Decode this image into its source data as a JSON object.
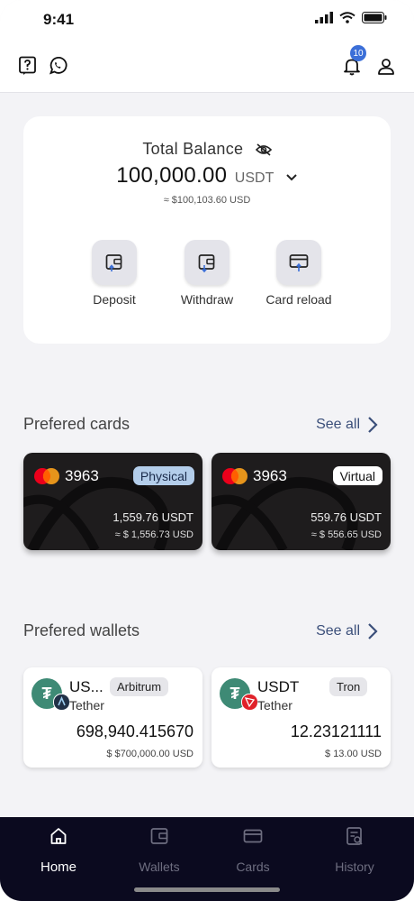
{
  "status_bar": {
    "time": "9:41"
  },
  "header": {
    "notification_count": "10"
  },
  "balance": {
    "label": "Total Balance",
    "amount": "100,000.00",
    "currency": "USDT",
    "usd_equivalent": "≈ $100,103.60  USD",
    "actions": [
      {
        "label": "Deposit",
        "icon": "wallet-in-icon"
      },
      {
        "label": "Withdraw",
        "icon": "wallet-out-icon"
      },
      {
        "label": "Card reload",
        "icon": "card-reload-icon"
      }
    ]
  },
  "preferred_cards": {
    "title": "Prefered cards",
    "see_all": "See all",
    "cards": [
      {
        "last_digits": "3963",
        "type": "Physical",
        "amount": "1,559.76  USDT",
        "usd": "≈ $ 1,556.73  USD",
        "tag_bg": "#b3cdea",
        "tag_color": "#1a2a4a"
      },
      {
        "last_digits": "3963",
        "type": "Virtual",
        "amount": "559.76  USDT",
        "usd": "≈ $ 556.65  USD",
        "tag_bg": "#ffffff",
        "tag_color": "#111111"
      }
    ]
  },
  "preferred_wallets": {
    "title": "Prefered wallets",
    "see_all": "See all",
    "wallets": [
      {
        "symbol": "US...",
        "name": "Tether",
        "network": "Arbitrum",
        "balance": "698,940.415670",
        "usd": "$  $700,000.00  USD",
        "network_icon": "arbitrum-icon"
      },
      {
        "symbol": "USDT",
        "name": "Tether",
        "network": "Tron",
        "balance": "12.23121111",
        "usd": "$  13.00  USD",
        "network_icon": "tron-icon"
      }
    ]
  },
  "nav": {
    "tabs": [
      {
        "label": "Home",
        "active": true,
        "icon": "home-icon"
      },
      {
        "label": "Wallets",
        "active": false,
        "icon": "wallet-icon"
      },
      {
        "label": "Cards",
        "active": false,
        "icon": "card-icon"
      },
      {
        "label": "History",
        "active": false,
        "icon": "history-icon"
      }
    ]
  },
  "colors": {
    "accent": "#3b6fd8",
    "nav_bg": "#0b0a1f",
    "card_bg": "#1e1c1d",
    "tether_green": "#3e8a75"
  }
}
